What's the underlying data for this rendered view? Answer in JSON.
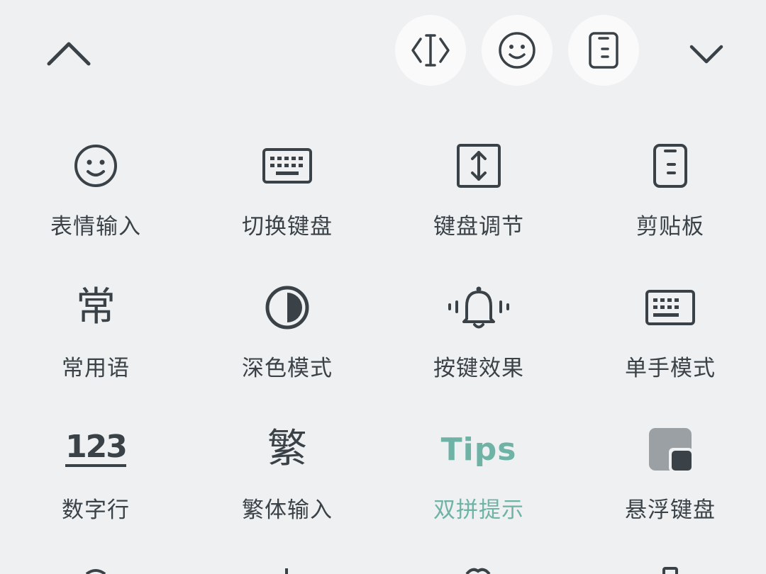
{
  "toolbar": {
    "collapse_icon": "chevron-up-icon",
    "cursor_icon": "text-cursor-move-icon",
    "emoji_icon": "smiley-icon",
    "clipboard_icon": "clipboard-icon",
    "hide_icon": "chevron-down-icon"
  },
  "grid": {
    "items": [
      {
        "label": "表情输入",
        "icon": "smiley-icon"
      },
      {
        "label": "切换键盘",
        "icon": "keyboard-icon"
      },
      {
        "label": "键盘调节",
        "icon": "resize-vertical-icon"
      },
      {
        "label": "剪贴板",
        "icon": "clipboard-icon"
      },
      {
        "label": "常用语",
        "icon": "phrase-char-icon",
        "glyph": "常"
      },
      {
        "label": "深色模式",
        "icon": "half-circle-icon"
      },
      {
        "label": "按键效果",
        "icon": "bell-vibrate-icon"
      },
      {
        "label": "单手模式",
        "icon": "keyboard-icon"
      },
      {
        "label": "数字行",
        "icon": "number-row-icon",
        "glyph": "123"
      },
      {
        "label": "繁体输入",
        "icon": "traditional-char-icon",
        "glyph": "繁"
      },
      {
        "label": "双拼提示",
        "icon": "tips-icon",
        "glyph": "Tips"
      },
      {
        "label": "悬浮键盘",
        "icon": "floating-window-icon"
      }
    ]
  },
  "colors": {
    "background": "#eef0f2",
    "icon": "#3a4247",
    "accent": "#6fb2a6",
    "circle_bg": "#fafafa",
    "float_gray": "#9aa0a4"
  }
}
